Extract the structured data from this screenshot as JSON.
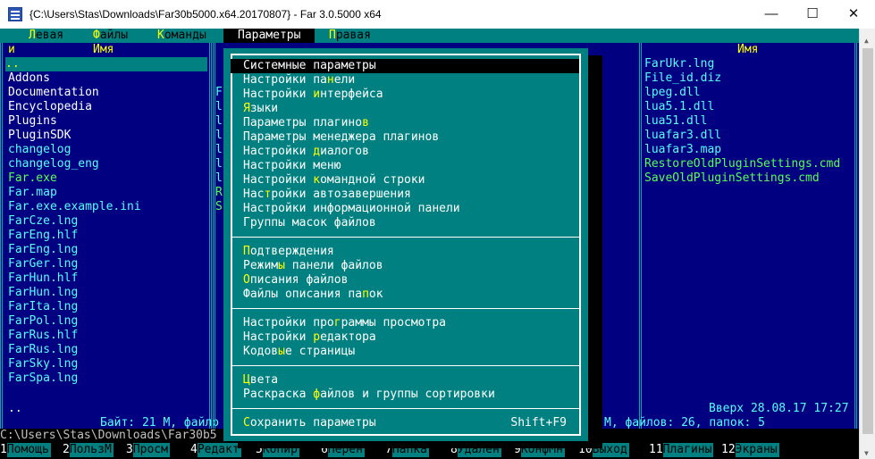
{
  "window": {
    "title": "{C:\\Users\\Stas\\Downloads\\Far30b5000.x64.20170807} - Far 3.0.5000 x64",
    "minimize_glyph": "—",
    "maximize_glyph": "☐",
    "close_glyph": "✕"
  },
  "menubar": [
    {
      "hotkey": "Л",
      "rest": "евая"
    },
    {
      "hotkey": "Ф",
      "rest": "айлы"
    },
    {
      "hotkey": "К",
      "rest": "оманды"
    },
    {
      "hotkey": "П",
      "rest": "араметры"
    },
    {
      "hotkey": "П",
      "rest": "равая"
    }
  ],
  "left_panel": {
    "col_header_n": "и",
    "col_header_name": "Имя",
    "cursor_item": "..",
    "files": [
      {
        "name": "Addons",
        "color": "white"
      },
      {
        "name": "Documentation",
        "color": "white"
      },
      {
        "name": "Encyclopedia",
        "color": "white"
      },
      {
        "name": "Plugins",
        "color": "white"
      },
      {
        "name": "PluginSDK",
        "color": "white"
      },
      {
        "name": "changelog",
        "color": "cyan"
      },
      {
        "name": "changelog_eng",
        "color": "cyan"
      },
      {
        "name": "Far.exe",
        "color": "green"
      },
      {
        "name": "Far.map",
        "color": "cyan"
      },
      {
        "name": "Far.exe.example.ini",
        "color": "cyan"
      },
      {
        "name": "FarCze.lng",
        "color": "cyan"
      },
      {
        "name": "FarEng.hlf",
        "color": "cyan"
      },
      {
        "name": "FarEng.lng",
        "color": "cyan"
      },
      {
        "name": "FarGer.lng",
        "color": "cyan"
      },
      {
        "name": "FarHun.hlf",
        "color": "cyan"
      },
      {
        "name": "FarHun.lng",
        "color": "cyan"
      },
      {
        "name": "FarIta.lng",
        "color": "cyan"
      },
      {
        "name": "FarPol.lng",
        "color": "cyan"
      },
      {
        "name": "FarRus.hlf",
        "color": "cyan"
      },
      {
        "name": "FarRus.lng",
        "color": "cyan"
      },
      {
        "name": "FarSky.lng",
        "color": "cyan"
      },
      {
        "name": "FarSpa.lng",
        "color": "cyan"
      }
    ],
    "selected_name": "..",
    "status": "Байт: 21 М, файло"
  },
  "middle_column": [
    {
      "ch": "F",
      "color": "cyan"
    },
    {
      "ch": "l",
      "color": "cyan"
    },
    {
      "ch": "l",
      "color": "cyan"
    },
    {
      "ch": "l",
      "color": "cyan"
    },
    {
      "ch": "l",
      "color": "cyan"
    },
    {
      "ch": "l",
      "color": "cyan"
    },
    {
      "ch": "l",
      "color": "cyan"
    },
    {
      "ch": "R",
      "color": "green"
    },
    {
      "ch": "S",
      "color": "green"
    }
  ],
  "right_panel": {
    "col_header_name": "Имя",
    "files": [
      {
        "name": "FarUkr.lng",
        "color": "cyan"
      },
      {
        "name": "File_id.diz",
        "color": "cyan"
      },
      {
        "name": "lpeg.dll",
        "color": "cyan"
      },
      {
        "name": "lua5.1.dll",
        "color": "cyan"
      },
      {
        "name": "lua51.dll",
        "color": "cyan"
      },
      {
        "name": "luafar3.dll",
        "color": "cyan"
      },
      {
        "name": "luafar3.map",
        "color": "cyan"
      },
      {
        "name": "RestoreOldPluginSettings.cmd",
        "color": "green"
      },
      {
        "name": "SaveOldPluginSettings.cmd",
        "color": "green"
      }
    ],
    "info_line": "Вверх 28.08.17 17:27",
    "status": "М, файлов: 26, папок: 5"
  },
  "dropdown": {
    "groups": [
      [
        {
          "pre": "Систе",
          "hk": "м",
          "post": "ные параметры",
          "selected": true
        },
        {
          "pre": "Настройки па",
          "hk": "н",
          "post": "ели"
        },
        {
          "pre": "Настройки ",
          "hk": "и",
          "post": "нтерфейса"
        },
        {
          "pre": "",
          "hk": "Я",
          "post": "зыки"
        },
        {
          "pre": "Параметры плагино",
          "hk": "в",
          "post": ""
        },
        {
          "pre": "Параметры менеджера плагинов",
          "hk": "",
          "post": ""
        },
        {
          "pre": "Настройки ",
          "hk": "д",
          "post": "иалогов"
        },
        {
          "pre": "Настройки меню",
          "hk": "",
          "post": ""
        },
        {
          "pre": "Настройки ",
          "hk": "к",
          "post": "омандной строки"
        },
        {
          "pre": "Нас",
          "hk": "т",
          "post": "ройки автозавершения"
        },
        {
          "pre": "Настройки информационной панели",
          "hk": "",
          "post": ""
        },
        {
          "pre": "Группы масок файлов",
          "hk": "",
          "post": ""
        }
      ],
      [
        {
          "pre": "",
          "hk": "П",
          "post": "одтверждения"
        },
        {
          "pre": "Режим",
          "hk": "ы",
          "post": " панели файлов"
        },
        {
          "pre": "",
          "hk": "О",
          "post": "писания файлов"
        },
        {
          "pre": "Файлы описания па",
          "hk": "п",
          "post": "ок"
        }
      ],
      [
        {
          "pre": "Настройки про",
          "hk": "г",
          "post": "раммы просмотра"
        },
        {
          "pre": "Настройки ",
          "hk": "р",
          "post": "едактора"
        },
        {
          "pre": "Кодов",
          "hk": "ы",
          "post": "е страницы"
        }
      ],
      [
        {
          "pre": "",
          "hk": "Ц",
          "post": "вета"
        },
        {
          "pre": "Раскраска ",
          "hk": "ф",
          "post": "айлов и группы сортировки"
        }
      ],
      [
        {
          "pre": "",
          "hk": "С",
          "post": "охранить параметры",
          "shortcut": "Shift+F9"
        }
      ]
    ]
  },
  "cmdline": "C:\\Users\\Stas\\Downloads\\Far30b5",
  "keybar": [
    {
      "num": "1",
      "label": "Помощь"
    },
    {
      "num": "2",
      "label": "ПользМ"
    },
    {
      "num": "3",
      "label": "Просм"
    },
    {
      "num": "4",
      "label": "Редакт"
    },
    {
      "num": "5",
      "label": "Копир"
    },
    {
      "num": "6",
      "label": "Перен"
    },
    {
      "num": "7",
      "label": "Папка"
    },
    {
      "num": "8",
      "label": "Удален"
    },
    {
      "num": "9",
      "label": "КонфМн"
    },
    {
      "num": "10",
      "label": "Выход"
    },
    {
      "num": "11",
      "label": "Плагины"
    },
    {
      "num": "12",
      "label": "Экраны"
    }
  ],
  "colors": {
    "panel_bg": "#000080",
    "menu_bg": "#008080",
    "hotkey": "#ffff00",
    "file_white": "#ffffff",
    "file_cyan": "#55ffff",
    "file_green": "#55ff55"
  }
}
